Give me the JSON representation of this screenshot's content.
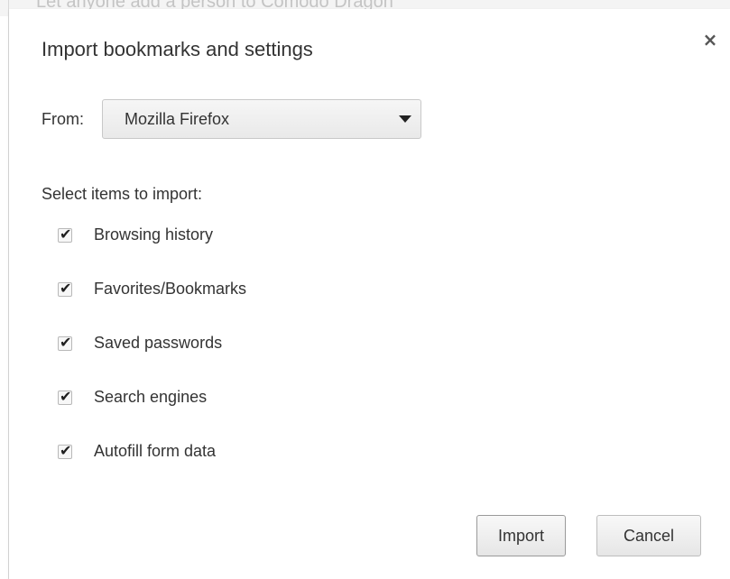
{
  "background": {
    "text": "Let anyone add a person to Comodo Dragon"
  },
  "dialog": {
    "title": "Import bookmarks and settings",
    "close_icon": "×",
    "from_label": "From:",
    "from_select": {
      "selected": "Mozilla Firefox"
    },
    "items_label": "Select items to import:",
    "items": [
      {
        "label": "Browsing history",
        "checked": true
      },
      {
        "label": "Favorites/Bookmarks",
        "checked": true
      },
      {
        "label": "Saved passwords",
        "checked": true
      },
      {
        "label": "Search engines",
        "checked": true
      },
      {
        "label": "Autofill form data",
        "checked": true
      }
    ],
    "buttons": {
      "import": "Import",
      "cancel": "Cancel"
    }
  }
}
